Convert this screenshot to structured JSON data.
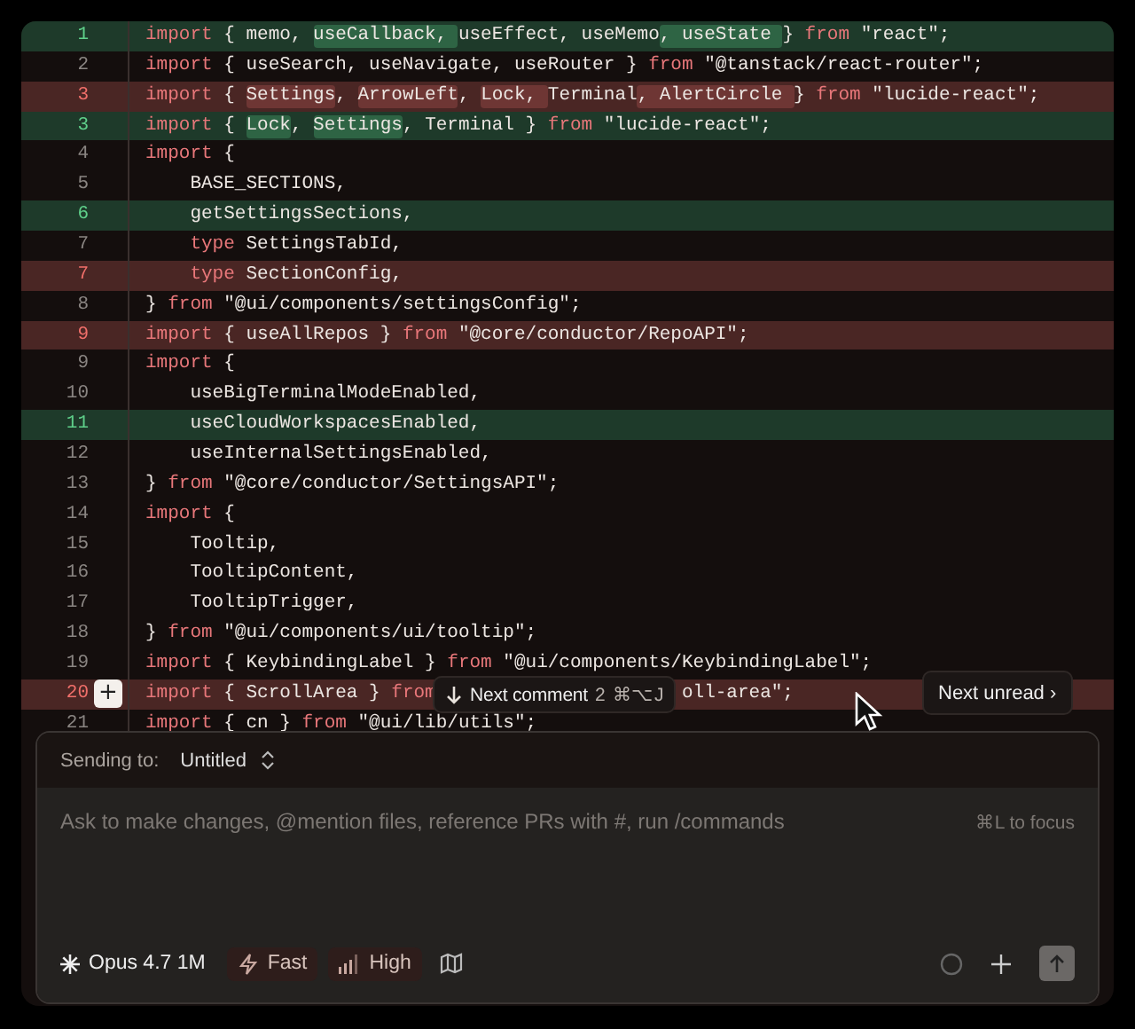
{
  "diff": {
    "lines": [
      {
        "number": "1",
        "kind": "added",
        "segments": [
          {
            "kind": "kw",
            "text": "import"
          },
          {
            "kind": "text",
            "text": " { memo, "
          },
          {
            "kind": "text",
            "text": "useCallback, ",
            "hl": true
          },
          {
            "kind": "text",
            "text": "useEffect, useMemo"
          },
          {
            "kind": "text",
            "text": ", useState ",
            "hl": true
          },
          {
            "kind": "text",
            "text": "} "
          },
          {
            "kind": "kw",
            "text": "from"
          },
          {
            "kind": "text",
            "text": " \"react\";"
          }
        ]
      },
      {
        "number": "2",
        "kind": "context",
        "segments": [
          {
            "kind": "kw",
            "text": "import"
          },
          {
            "kind": "text",
            "text": " { useSearch, useNavigate, useRouter } "
          },
          {
            "kind": "kw",
            "text": "from"
          },
          {
            "kind": "text",
            "text": " \"@tanstack/react-router\";"
          }
        ]
      },
      {
        "number": "3",
        "kind": "removed",
        "segments": [
          {
            "kind": "kw",
            "text": "import"
          },
          {
            "kind": "text",
            "text": " { "
          },
          {
            "kind": "text",
            "text": "Settings",
            "hl": true
          },
          {
            "kind": "text",
            "text": ", "
          },
          {
            "kind": "text",
            "text": "ArrowLeft",
            "hl": true
          },
          {
            "kind": "text",
            "text": ", "
          },
          {
            "kind": "text",
            "text": "Lock, ",
            "hl": true
          },
          {
            "kind": "text",
            "text": "Terminal"
          },
          {
            "kind": "text",
            "text": ", AlertCircle ",
            "hl": true
          },
          {
            "kind": "text",
            "text": "} "
          },
          {
            "kind": "kw",
            "text": "from"
          },
          {
            "kind": "text",
            "text": " \"lucide-react\";"
          }
        ]
      },
      {
        "number": "3",
        "kind": "added",
        "segments": [
          {
            "kind": "kw",
            "text": "import"
          },
          {
            "kind": "text",
            "text": " { "
          },
          {
            "kind": "text",
            "text": "Lock",
            "hl": true
          },
          {
            "kind": "text",
            "text": ", "
          },
          {
            "kind": "text",
            "text": "Settings",
            "hl": true
          },
          {
            "kind": "text",
            "text": ", Terminal } "
          },
          {
            "kind": "kw",
            "text": "from"
          },
          {
            "kind": "text",
            "text": " \"lucide-react\";"
          }
        ]
      },
      {
        "number": "4",
        "kind": "context",
        "segments": [
          {
            "kind": "kw",
            "text": "import"
          },
          {
            "kind": "text",
            "text": " {"
          }
        ]
      },
      {
        "number": "5",
        "kind": "context",
        "indented": true,
        "segments": [
          {
            "kind": "text",
            "text": "BASE_SECTIONS,"
          }
        ]
      },
      {
        "number": "6",
        "kind": "added",
        "indented": true,
        "segments": [
          {
            "kind": "text",
            "text": "getSettingsSections,"
          }
        ]
      },
      {
        "number": "7",
        "kind": "context",
        "indented": true,
        "segments": [
          {
            "kind": "kw",
            "text": "type"
          },
          {
            "kind": "text",
            "text": " SettingsTabId,"
          }
        ]
      },
      {
        "number": "7",
        "kind": "removed",
        "indented": true,
        "segments": [
          {
            "kind": "kw",
            "text": "type"
          },
          {
            "kind": "text",
            "text": " SectionConfig,"
          }
        ]
      },
      {
        "number": "8",
        "kind": "context",
        "segments": [
          {
            "kind": "text",
            "text": "} "
          },
          {
            "kind": "kw",
            "text": "from"
          },
          {
            "kind": "text",
            "text": " \"@ui/components/settingsConfig\";"
          }
        ]
      },
      {
        "number": "9",
        "kind": "removed",
        "segments": [
          {
            "kind": "kw",
            "text": "import"
          },
          {
            "kind": "text",
            "text": " { useAllRepos } "
          },
          {
            "kind": "kw",
            "text": "from"
          },
          {
            "kind": "text",
            "text": " \"@core/conductor/RepoAPI\";"
          }
        ]
      },
      {
        "number": "9",
        "kind": "context",
        "segments": [
          {
            "kind": "kw",
            "text": "import"
          },
          {
            "kind": "text",
            "text": " {"
          }
        ]
      },
      {
        "number": "10",
        "kind": "context",
        "indented": true,
        "segments": [
          {
            "kind": "text",
            "text": "useBigTerminalModeEnabled,"
          }
        ]
      },
      {
        "number": "11",
        "kind": "added",
        "indented": true,
        "segments": [
          {
            "kind": "text",
            "text": "useCloudWorkspacesEnabled,"
          }
        ]
      },
      {
        "number": "12",
        "kind": "context",
        "indented": true,
        "segments": [
          {
            "kind": "text",
            "text": "useInternalSettingsEnabled,"
          }
        ]
      },
      {
        "number": "13",
        "kind": "context",
        "segments": [
          {
            "kind": "text",
            "text": "} "
          },
          {
            "kind": "kw",
            "text": "from"
          },
          {
            "kind": "text",
            "text": " \"@core/conductor/SettingsAPI\";"
          }
        ]
      },
      {
        "number": "14",
        "kind": "context",
        "segments": [
          {
            "kind": "kw",
            "text": "import"
          },
          {
            "kind": "text",
            "text": " {"
          }
        ]
      },
      {
        "number": "15",
        "kind": "context",
        "indented": true,
        "segments": [
          {
            "kind": "text",
            "text": "Tooltip,"
          }
        ]
      },
      {
        "number": "16",
        "kind": "context",
        "indented": true,
        "segments": [
          {
            "kind": "text",
            "text": "TooltipContent,"
          }
        ]
      },
      {
        "number": "17",
        "kind": "context",
        "indented": true,
        "segments": [
          {
            "kind": "text",
            "text": "TooltipTrigger,"
          }
        ]
      },
      {
        "number": "18",
        "kind": "context",
        "segments": [
          {
            "kind": "text",
            "text": "} "
          },
          {
            "kind": "kw",
            "text": "from"
          },
          {
            "kind": "text",
            "text": " \"@ui/components/ui/tooltip\";"
          }
        ]
      },
      {
        "number": "19",
        "kind": "context",
        "segments": [
          {
            "kind": "kw",
            "text": "import"
          },
          {
            "kind": "text",
            "text": " { KeybindingLabel } "
          },
          {
            "kind": "kw",
            "text": "from"
          },
          {
            "kind": "text",
            "text": " \"@ui/components/KeybindingLabel\";"
          }
        ]
      },
      {
        "number": "20",
        "kind": "removed",
        "comment_button": "+",
        "segments": [
          {
            "kind": "kw",
            "text": "import"
          },
          {
            "kind": "text",
            "text": " { ScrollArea } "
          },
          {
            "kind": "kw",
            "text": "from"
          },
          {
            "kind": "text",
            "text": "oll-area\";",
            "after_tooltip": true
          }
        ]
      },
      {
        "number": "21",
        "kind": "context",
        "segments": [
          {
            "kind": "kw",
            "text": "import"
          },
          {
            "kind": "text",
            "text": " { cn } "
          },
          {
            "kind": "kw",
            "text": "from"
          },
          {
            "kind": "text",
            "text": " \"@ui/lib/utils\";"
          }
        ]
      }
    ]
  },
  "next_comment": {
    "label": "Next comment",
    "count": "2",
    "shortcut": "⌘⌥J"
  },
  "next_unread": {
    "label": "Next unread",
    "chevron": "›"
  },
  "composer": {
    "sending_to_label": "Sending to:",
    "target": "Untitled",
    "placeholder": "Ask to make changes, @mention files, reference PRs with #, run /commands",
    "focus_hint": "⌘L to focus",
    "model": "Opus 4.7 1M",
    "speed": "Fast",
    "effort": "High"
  }
}
